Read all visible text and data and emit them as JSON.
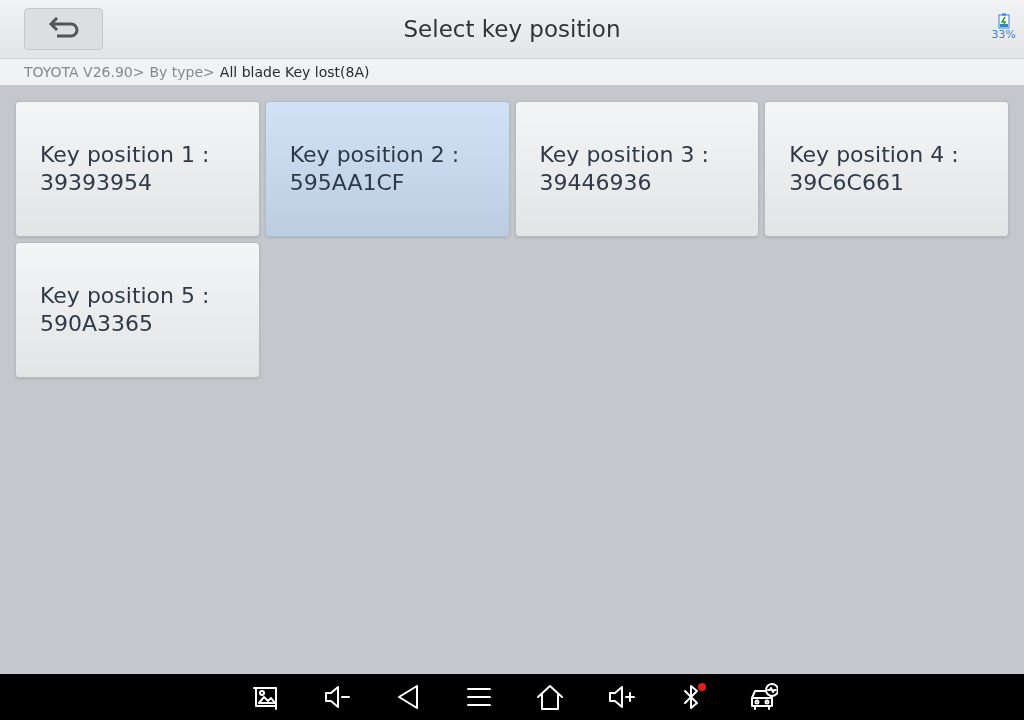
{
  "header": {
    "title": "Select key position",
    "battery": "33%"
  },
  "breadcrumb": [
    {
      "label": "TOYOTA V26.90>",
      "current": false
    },
    {
      "label": "By type>",
      "current": false
    },
    {
      "label": "All blade Key lost(8A)",
      "current": true
    }
  ],
  "keys": [
    {
      "label": "Key position 1 :",
      "value": "39393954",
      "selected": false
    },
    {
      "label": "Key position 2 :",
      "value": "595AA1CF",
      "selected": true
    },
    {
      "label": "Key position 3 :",
      "value": "39446936",
      "selected": false
    },
    {
      "label": "Key position 4 :",
      "value": "39C6C661",
      "selected": false
    },
    {
      "label": "Key position 5 :",
      "value": "590A3365",
      "selected": false
    }
  ],
  "navbar": [
    {
      "kind": "screenshot"
    },
    {
      "kind": "volume-down"
    },
    {
      "kind": "back"
    },
    {
      "kind": "menu"
    },
    {
      "kind": "home"
    },
    {
      "kind": "volume-up"
    },
    {
      "kind": "bluetooth"
    },
    {
      "kind": "car"
    }
  ]
}
